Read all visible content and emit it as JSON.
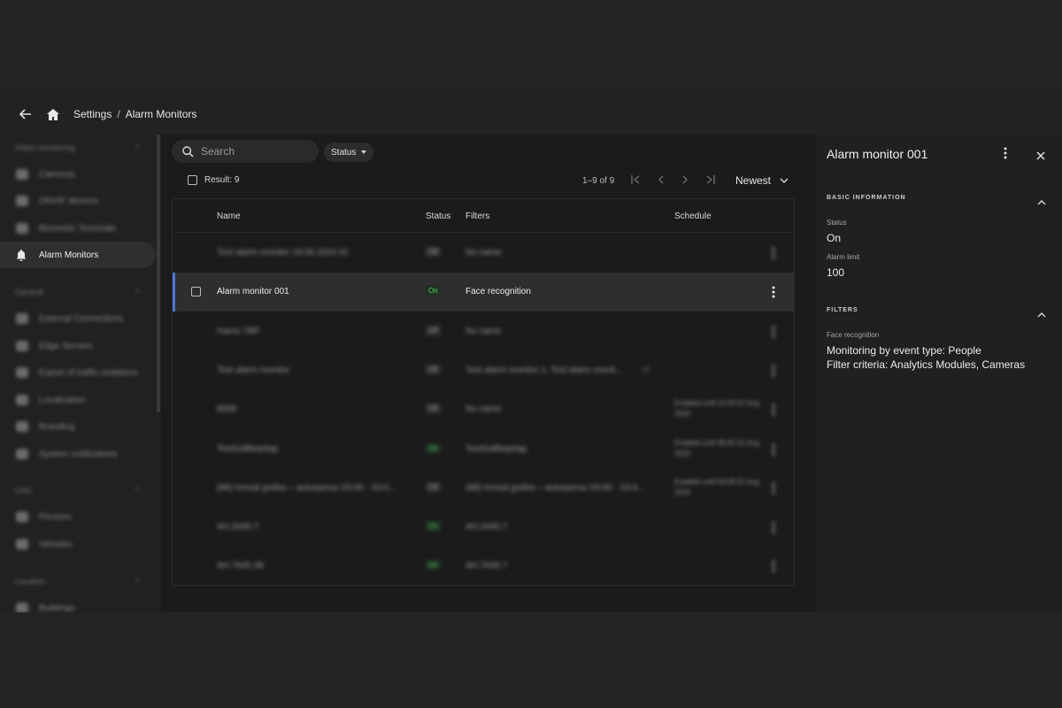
{
  "breadcrumb": {
    "root": "Settings",
    "separator": "/",
    "current": "Alarm Monitors"
  },
  "sidebar": {
    "groups": [
      {
        "label": "Video monitoring"
      },
      {
        "label": "General"
      },
      {
        "label": "Lists"
      },
      {
        "label": "Location"
      }
    ],
    "items": [
      {
        "label": "Cameras",
        "icon": "camera-icon"
      },
      {
        "label": "ONVIF devices",
        "icon": "onvif-icon"
      },
      {
        "label": "Biometric Terminals",
        "icon": "terminal-icon"
      },
      {
        "label": "Alarm Monitors",
        "icon": "bell-icon"
      },
      {
        "label": "External Connections",
        "icon": "plug-icon"
      },
      {
        "label": "Edge Servers",
        "icon": "server-icon"
      },
      {
        "label": "Export of traffic violations",
        "icon": "export-icon"
      },
      {
        "label": "Localization",
        "icon": "globe-icon"
      },
      {
        "label": "Branding",
        "icon": "palette-icon"
      },
      {
        "label": "System notifications",
        "icon": "notification-icon"
      },
      {
        "label": "Persons",
        "icon": "person-icon"
      },
      {
        "label": "Vehicles",
        "icon": "vehicle-icon"
      },
      {
        "label": "Buildings",
        "icon": "building-icon"
      }
    ]
  },
  "toolbar": {
    "search_placeholder": "Search",
    "status_filter_label": "Status",
    "result_label": "Result: 9",
    "pagination": "1–9 of 9",
    "sort_label": "Newest"
  },
  "table": {
    "columns": {
      "name": "Name",
      "status": "Status",
      "filters": "Filters",
      "schedule": "Schedule"
    },
    "rows": [
      {
        "name": "Test alarm monitor 19.08.2024 #1",
        "status": "Off",
        "filters": "No name",
        "schedule": ""
      },
      {
        "name": "Alarm monitor 001",
        "status": "On",
        "filters": "Face recognition",
        "schedule": ""
      },
      {
        "name": "Harris TBP",
        "status": "Off",
        "filters": "No name",
        "schedule": ""
      },
      {
        "name": "Test alarm monitor",
        "status": "Off",
        "filters": "Test alarm monitor 1, Test alarm monit...",
        "extra": "+1",
        "schedule": ""
      },
      {
        "name": "8908",
        "status": "Off",
        "filters": "No name",
        "schedule": "Enabled until 12:00 01 Aug 2024"
      },
      {
        "name": "TestGallbepItap",
        "status": "On",
        "filters": "TestGallbepItap",
        "schedule": "Enabled until 08:45 01 Aug 2024"
      },
      {
        "name": "(88) Inmod grafes – anturpersu 03:00 - 23:0...",
        "status": "Off",
        "filters": "(88) Inmod grafes – anturpersu 03:00 - 23:0...",
        "schedule": "Enabled until 03:09 01 Aug 2024"
      },
      {
        "name": "AH.3445.7",
        "status": "On",
        "filters": "AH.3445.7",
        "schedule": ""
      },
      {
        "name": "AH.7645.38",
        "status": "On",
        "filters": "AH.7645.7",
        "schedule": ""
      }
    ]
  },
  "detail": {
    "title": "Alarm monitor 001",
    "basic_section": "BASIC INFORMATION",
    "status_label": "Status",
    "status_value": "On",
    "limit_label": "Alarm limit",
    "limit_value": "100",
    "filters_section": "FILTERS",
    "filter_type_label": "Face recognition",
    "filter_line1": "Monitoring by event type: People",
    "filter_line2": "Filter criteria: Analytics Modules, Cameras"
  },
  "colors": {
    "accent": "#4a78d6",
    "status_on": "#5fcf6a",
    "background": "#1b1b1b"
  }
}
